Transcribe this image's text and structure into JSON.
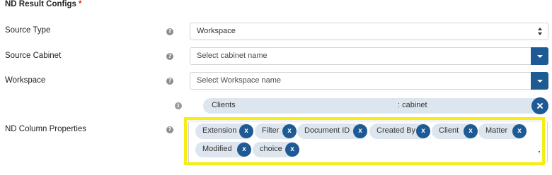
{
  "section": {
    "title": "ND Result Configs",
    "required_mark": "*"
  },
  "help_glyph": "?",
  "info_glyph": "i",
  "rows": {
    "source_type": {
      "label": "Source Type",
      "value": "Workspace"
    },
    "source_cabinet": {
      "label": "Source Cabinet",
      "placeholder": "Select cabinet name"
    },
    "workspace": {
      "label": "Workspace",
      "placeholder": "Select Workspace name"
    },
    "nd_column_properties": {
      "label": "ND Column Properties"
    }
  },
  "selected_cabinet": {
    "name": "Clients",
    "type": ": cabinet"
  },
  "column_tags": [
    {
      "label": "Extension",
      "remove": "x"
    },
    {
      "label": "Filter",
      "remove": "x"
    },
    {
      "label": "Document ID",
      "remove": "x"
    },
    {
      "label": "Created By",
      "remove": "x"
    },
    {
      "label": "Client",
      "remove": "x"
    },
    {
      "label": "Matter",
      "remove": "x"
    },
    {
      "label": "Modified",
      "remove": "x"
    },
    {
      "label": "choice",
      "remove": "x"
    }
  ],
  "colors": {
    "accent": "#1e5a94",
    "chip_bg": "#dde6ef",
    "highlight": "#f5ed13",
    "required": "#d9261c"
  }
}
